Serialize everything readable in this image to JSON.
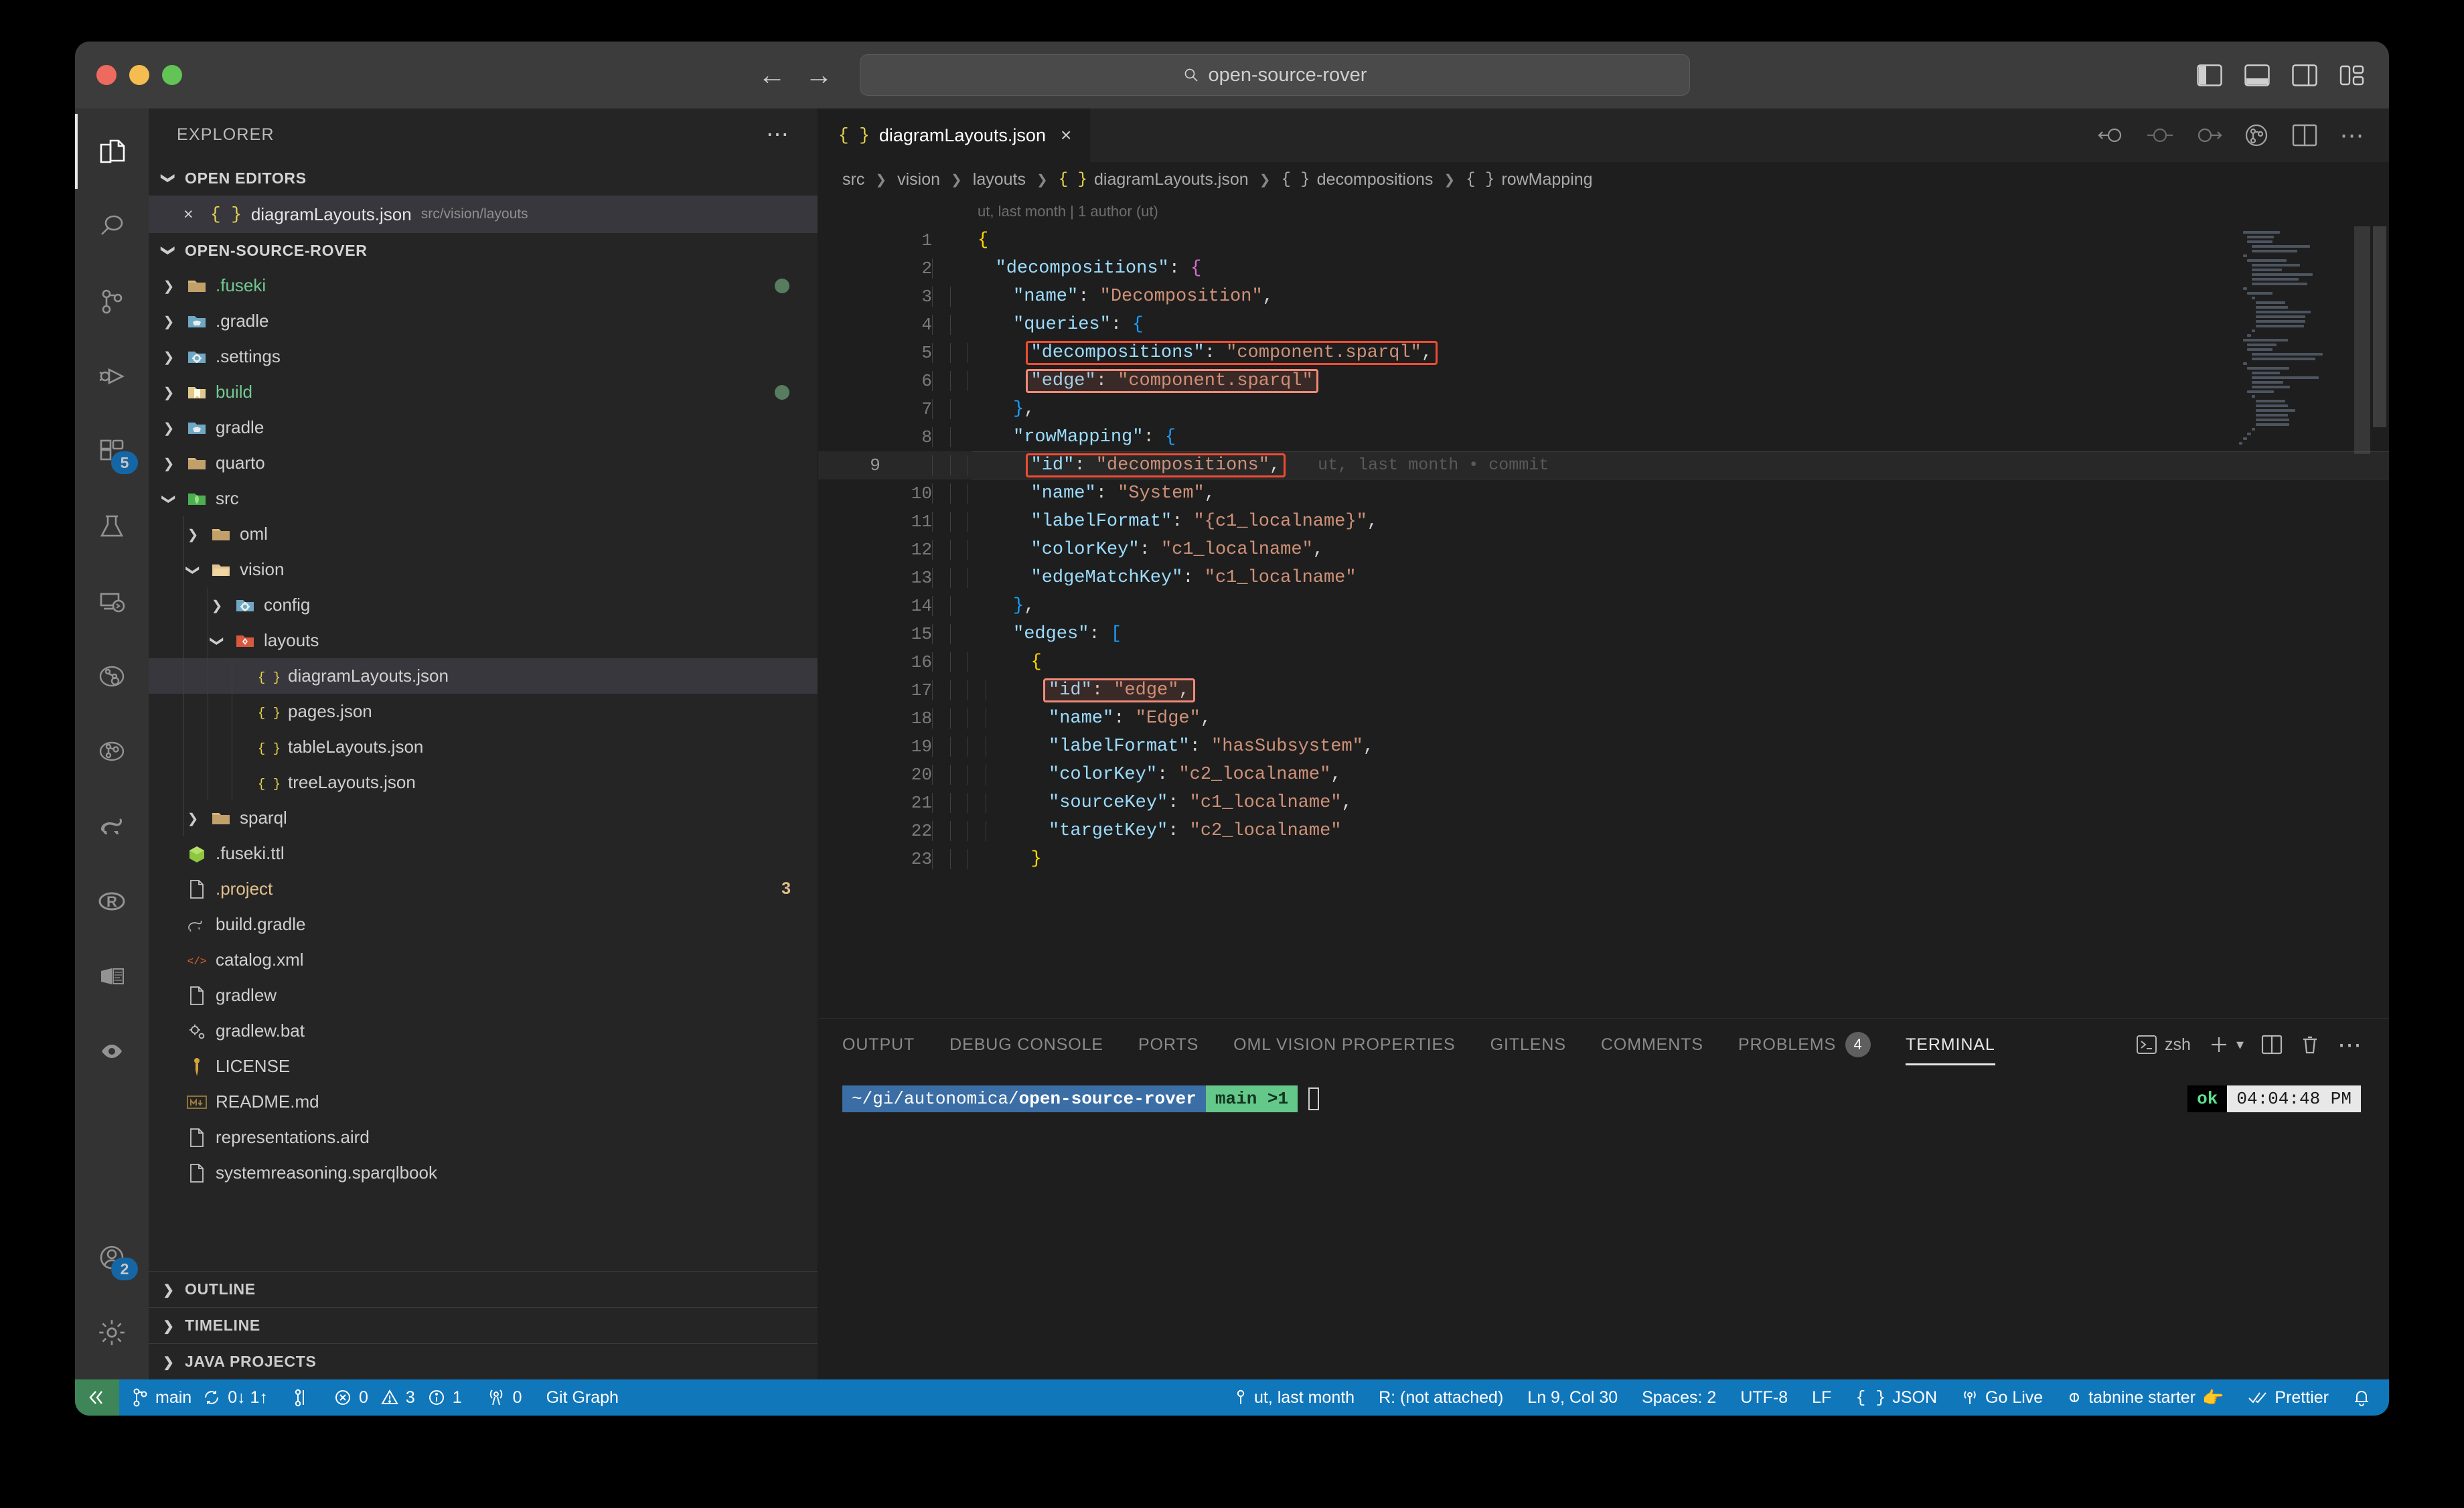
{
  "titlebar": {
    "search_value": "open-source-rover",
    "nav_back": "←",
    "nav_forward": "→"
  },
  "activitybar": {
    "items": [
      {
        "name": "explorer",
        "icon": "files-icon",
        "badge": null,
        "active": true
      },
      {
        "name": "search",
        "icon": "search-icon",
        "badge": null,
        "active": false
      },
      {
        "name": "source-control",
        "icon": "source-control-icon",
        "badge": null,
        "active": false
      },
      {
        "name": "run-and-debug",
        "icon": "run-debug-icon",
        "badge": null,
        "active": false
      },
      {
        "name": "extensions",
        "icon": "extensions-icon",
        "badge": "5",
        "active": false
      },
      {
        "name": "testing",
        "icon": "beaker-icon",
        "badge": null,
        "active": false
      },
      {
        "name": "remote-explorer",
        "icon": "remote-explorer-icon",
        "badge": null,
        "active": false
      },
      {
        "name": "oml-vision",
        "icon": "oml-vision-icon",
        "badge": null,
        "active": false
      },
      {
        "name": "graph-explorer",
        "icon": "graph-circle-icon",
        "badge": null,
        "active": false
      },
      {
        "name": "gradle",
        "icon": "gradle-elephant-icon",
        "badge": null,
        "active": false
      },
      {
        "name": "r-language",
        "icon": "r-icon",
        "badge": null,
        "active": false
      },
      {
        "name": "sirius-web",
        "icon": "sirius-icon",
        "badge": null,
        "active": false
      },
      {
        "name": "watcher",
        "icon": "eye-icon",
        "badge": null,
        "active": false
      }
    ],
    "bottom_items": [
      {
        "name": "accounts",
        "icon": "account-icon",
        "badge": "2"
      },
      {
        "name": "manage-settings",
        "icon": "gear-icon",
        "badge": null
      }
    ]
  },
  "sidebar": {
    "title": "EXPLORER",
    "more_actions": "⋯",
    "open_editors": {
      "label": "OPEN EDITORS",
      "expanded": true,
      "items": [
        {
          "name": "diagramLayouts.json",
          "path": "src/vision/layouts",
          "icon": "json-icon",
          "close": "×",
          "selected": true
        }
      ]
    },
    "workspace": {
      "label": "OPEN-SOURCE-ROVER",
      "expanded": true,
      "tree": [
        {
          "label": ".fuseki",
          "depth": 1,
          "type": "folder",
          "state": "collapsed",
          "icon": "folder-tan-icon",
          "color": "green",
          "dot": true
        },
        {
          "label": ".gradle",
          "depth": 1,
          "type": "folder",
          "state": "collapsed",
          "icon": "folder-gradle-icon",
          "color": "plain",
          "dot": false
        },
        {
          "label": ".settings",
          "depth": 1,
          "type": "folder",
          "state": "collapsed",
          "icon": "folder-config-icon",
          "color": "plain",
          "dot": false
        },
        {
          "label": "build",
          "depth": 1,
          "type": "folder",
          "state": "collapsed",
          "icon": "folder-build-icon",
          "color": "green",
          "dot": true
        },
        {
          "label": "gradle",
          "depth": 1,
          "type": "folder",
          "state": "collapsed",
          "icon": "folder-gradle-icon",
          "color": "plain",
          "dot": false
        },
        {
          "label": "quarto",
          "depth": 1,
          "type": "folder",
          "state": "collapsed",
          "icon": "folder-tan-icon",
          "color": "plain",
          "dot": false
        },
        {
          "label": "src",
          "depth": 1,
          "type": "folder",
          "state": "expanded",
          "icon": "folder-src-icon",
          "color": "plain",
          "dot": false
        },
        {
          "label": "oml",
          "depth": 2,
          "type": "folder",
          "state": "collapsed",
          "icon": "folder-tan-icon",
          "color": "plain",
          "dot": false
        },
        {
          "label": "vision",
          "depth": 2,
          "type": "folder",
          "state": "expanded",
          "icon": "folder-tan-open-icon",
          "color": "plain",
          "dot": false
        },
        {
          "label": "config",
          "depth": 3,
          "type": "folder",
          "state": "collapsed",
          "icon": "folder-config-icon",
          "color": "plain",
          "dot": false
        },
        {
          "label": "layouts",
          "depth": 3,
          "type": "folder",
          "state": "expanded",
          "icon": "folder-layouts-icon",
          "color": "plain",
          "dot": false
        },
        {
          "label": "diagramLayouts.json",
          "depth": 4,
          "type": "file",
          "icon": "json-icon",
          "color": "plain",
          "selected": true,
          "dot": false
        },
        {
          "label": "pages.json",
          "depth": 4,
          "type": "file",
          "icon": "json-icon",
          "color": "plain",
          "dot": false
        },
        {
          "label": "tableLayouts.json",
          "depth": 4,
          "type": "file",
          "icon": "json-icon",
          "color": "plain",
          "dot": false
        },
        {
          "label": "treeLayouts.json",
          "depth": 4,
          "type": "file",
          "icon": "json-icon",
          "color": "plain",
          "dot": false
        },
        {
          "label": "sparql",
          "depth": 2,
          "type": "folder",
          "state": "collapsed",
          "icon": "folder-tan-icon",
          "color": "plain",
          "dot": false
        },
        {
          "label": ".fuseki.ttl",
          "depth": 1,
          "type": "file",
          "icon": "ttl-icon",
          "color": "plain",
          "dot": false
        },
        {
          "label": ".project",
          "depth": 1,
          "type": "file",
          "icon": "file-icon",
          "color": "yellow",
          "count": "3",
          "dot": false
        },
        {
          "label": "build.gradle",
          "depth": 1,
          "type": "file",
          "icon": "gradle-file-icon",
          "color": "plain",
          "dot": false
        },
        {
          "label": "catalog.xml",
          "depth": 1,
          "type": "file",
          "icon": "xml-icon",
          "color": "plain",
          "dot": false
        },
        {
          "label": "gradlew",
          "depth": 1,
          "type": "file",
          "icon": "file-icon",
          "color": "plain",
          "dot": false
        },
        {
          "label": "gradlew.bat",
          "depth": 1,
          "type": "file",
          "icon": "bat-icon",
          "color": "plain",
          "dot": false
        },
        {
          "label": "LICENSE",
          "depth": 1,
          "type": "file",
          "icon": "license-icon",
          "color": "plain",
          "dot": false
        },
        {
          "label": "README.md",
          "depth": 1,
          "type": "file",
          "icon": "markdown-icon",
          "color": "plain",
          "dot": false
        },
        {
          "label": "representations.aird",
          "depth": 1,
          "type": "file",
          "icon": "file-icon",
          "color": "plain",
          "dot": false
        },
        {
          "label": "systemreasoning.sparqlbook",
          "depth": 1,
          "type": "file",
          "icon": "file-icon",
          "color": "plain",
          "dot": false
        }
      ]
    },
    "bottom_sections": [
      {
        "label": "OUTLINE"
      },
      {
        "label": "TIMELINE"
      },
      {
        "label": "JAVA PROJECTS"
      }
    ]
  },
  "editor": {
    "tab": {
      "name": "diagramLayouts.json",
      "icon": "json-icon",
      "close": "×"
    },
    "actions": [
      "go-back-icon",
      "no-change-icon",
      "go-forward-icon",
      "git-compare-icon",
      "split-editor-icon",
      "more-actions-icon"
    ],
    "breadcrumb": [
      "src",
      "vision",
      "layouts",
      "diagramLayouts.json",
      "decompositions",
      "rowMapping"
    ],
    "blame_header": "ut, last month | 1 author (ut)",
    "inline_blame": "ut, last month • commit",
    "cursor_line": 9,
    "lines": [
      {
        "n": 1,
        "indent": 0,
        "tokens": [
          {
            "t": "{",
            "c": "br-y"
          }
        ]
      },
      {
        "n": 2,
        "indent": 1,
        "tokens": [
          {
            "t": "\"decompositions\"",
            "c": "k"
          },
          {
            "t": ": ",
            "c": "p"
          },
          {
            "t": "{",
            "c": "br-p"
          }
        ]
      },
      {
        "n": 3,
        "indent": 2,
        "tokens": [
          {
            "t": "\"name\"",
            "c": "k"
          },
          {
            "t": ": ",
            "c": "p"
          },
          {
            "t": "\"Decomposition\"",
            "c": "s"
          },
          {
            "t": ",",
            "c": "p"
          }
        ]
      },
      {
        "n": 4,
        "indent": 2,
        "tokens": [
          {
            "t": "\"queries\"",
            "c": "k"
          },
          {
            "t": ": ",
            "c": "p"
          },
          {
            "t": "{",
            "c": "br-b"
          }
        ]
      },
      {
        "n": 5,
        "indent": 3,
        "tokens": [
          {
            "t": "\"decompositions\"",
            "c": "k"
          },
          {
            "t": ": ",
            "c": "p"
          },
          {
            "t": "\"component.sparql\"",
            "c": "s"
          },
          {
            "t": ",",
            "c": "p"
          }
        ],
        "highlight": "strong"
      },
      {
        "n": 6,
        "indent": 3,
        "tokens": [
          {
            "t": "\"edge\"",
            "c": "k"
          },
          {
            "t": ": ",
            "c": "p"
          },
          {
            "t": "\"component.sparql\"",
            "c": "s"
          }
        ],
        "highlight": "soft"
      },
      {
        "n": 7,
        "indent": 2,
        "tokens": [
          {
            "t": "}",
            "c": "br-b"
          },
          {
            "t": ",",
            "c": "p"
          }
        ]
      },
      {
        "n": 8,
        "indent": 2,
        "tokens": [
          {
            "t": "\"rowMapping\"",
            "c": "k"
          },
          {
            "t": ": ",
            "c": "p"
          },
          {
            "t": "{",
            "c": "br-b"
          }
        ]
      },
      {
        "n": 9,
        "indent": 3,
        "tokens": [
          {
            "t": "\"id\"",
            "c": "k"
          },
          {
            "t": ": ",
            "c": "p"
          },
          {
            "t": "\"decompositions\"",
            "c": "s"
          },
          {
            "t": ",",
            "c": "p"
          }
        ],
        "highlight": "strong",
        "blame": true
      },
      {
        "n": 10,
        "indent": 3,
        "tokens": [
          {
            "t": "\"name\"",
            "c": "k"
          },
          {
            "t": ": ",
            "c": "p"
          },
          {
            "t": "\"System\"",
            "c": "s"
          },
          {
            "t": ",",
            "c": "p"
          }
        ]
      },
      {
        "n": 11,
        "indent": 3,
        "tokens": [
          {
            "t": "\"labelFormat\"",
            "c": "k"
          },
          {
            "t": ": ",
            "c": "p"
          },
          {
            "t": "\"{c1_localname}\"",
            "c": "s"
          },
          {
            "t": ",",
            "c": "p"
          }
        ]
      },
      {
        "n": 12,
        "indent": 3,
        "tokens": [
          {
            "t": "\"colorKey\"",
            "c": "k"
          },
          {
            "t": ": ",
            "c": "p"
          },
          {
            "t": "\"c1_localname\"",
            "c": "s"
          },
          {
            "t": ",",
            "c": "p"
          }
        ]
      },
      {
        "n": 13,
        "indent": 3,
        "tokens": [
          {
            "t": "\"edgeMatchKey\"",
            "c": "k"
          },
          {
            "t": ": ",
            "c": "p"
          },
          {
            "t": "\"c1_localname\"",
            "c": "s"
          }
        ]
      },
      {
        "n": 14,
        "indent": 2,
        "tokens": [
          {
            "t": "}",
            "c": "br-b"
          },
          {
            "t": ",",
            "c": "p"
          }
        ]
      },
      {
        "n": 15,
        "indent": 2,
        "tokens": [
          {
            "t": "\"edges\"",
            "c": "k"
          },
          {
            "t": ": ",
            "c": "p"
          },
          {
            "t": "[",
            "c": "br-b"
          }
        ]
      },
      {
        "n": 16,
        "indent": 3,
        "tokens": [
          {
            "t": "{",
            "c": "br-y"
          }
        ]
      },
      {
        "n": 17,
        "indent": 4,
        "tokens": [
          {
            "t": "\"id\"",
            "c": "k"
          },
          {
            "t": ": ",
            "c": "p"
          },
          {
            "t": "\"edge\"",
            "c": "s"
          },
          {
            "t": ",",
            "c": "p"
          }
        ],
        "highlight": "soft"
      },
      {
        "n": 18,
        "indent": 4,
        "tokens": [
          {
            "t": "\"name\"",
            "c": "k"
          },
          {
            "t": ": ",
            "c": "p"
          },
          {
            "t": "\"Edge\"",
            "c": "s"
          },
          {
            "t": ",",
            "c": "p"
          }
        ]
      },
      {
        "n": 19,
        "indent": 4,
        "tokens": [
          {
            "t": "\"labelFormat\"",
            "c": "k"
          },
          {
            "t": ": ",
            "c": "p"
          },
          {
            "t": "\"hasSubsystem\"",
            "c": "s"
          },
          {
            "t": ",",
            "c": "p"
          }
        ]
      },
      {
        "n": 20,
        "indent": 4,
        "tokens": [
          {
            "t": "\"colorKey\"",
            "c": "k"
          },
          {
            "t": ": ",
            "c": "p"
          },
          {
            "t": "\"c2_localname\"",
            "c": "s"
          },
          {
            "t": ",",
            "c": "p"
          }
        ]
      },
      {
        "n": 21,
        "indent": 4,
        "tokens": [
          {
            "t": "\"sourceKey\"",
            "c": "k"
          },
          {
            "t": ": ",
            "c": "p"
          },
          {
            "t": "\"c1_localname\"",
            "c": "s"
          },
          {
            "t": ",",
            "c": "p"
          }
        ]
      },
      {
        "n": 22,
        "indent": 4,
        "tokens": [
          {
            "t": "\"targetKey\"",
            "c": "k"
          },
          {
            "t": ": ",
            "c": "p"
          },
          {
            "t": "\"c2_localname\"",
            "c": "s"
          }
        ]
      },
      {
        "n": 23,
        "indent": 3,
        "tokens": [
          {
            "t": "}",
            "c": "br-y"
          }
        ]
      }
    ]
  },
  "panel": {
    "tabs": [
      {
        "label": "OUTPUT",
        "active": false,
        "badge": null
      },
      {
        "label": "DEBUG CONSOLE",
        "active": false,
        "badge": null
      },
      {
        "label": "PORTS",
        "active": false,
        "badge": null
      },
      {
        "label": "OML VISION PROPERTIES",
        "active": false,
        "badge": null
      },
      {
        "label": "GITLENS",
        "active": false,
        "badge": null
      },
      {
        "label": "COMMENTS",
        "active": false,
        "badge": null
      },
      {
        "label": "PROBLEMS",
        "active": false,
        "badge": "4"
      },
      {
        "label": "TERMINAL",
        "active": true,
        "badge": null
      }
    ],
    "shell": "zsh",
    "actions": [
      "terminal-icon",
      "new-terminal-icon",
      "chevron-down-icon",
      "split-terminal-icon",
      "kill-terminal-icon",
      "more-actions-icon"
    ],
    "terminal": {
      "path_prefix": "~/gi/autonomica/",
      "path_repo": "open-source-rover",
      "branch": "main >1",
      "status": "ok",
      "time": "04:04:48 PM"
    }
  },
  "statusbar": {
    "left": [
      {
        "name": "remote-indicator",
        "label": "",
        "icon": "remote-icon"
      },
      {
        "name": "branch",
        "label": "main",
        "icon": "git-branch-icon"
      },
      {
        "name": "sync",
        "label": "0↓ 1↑",
        "icon": "sync-icon"
      },
      {
        "name": "git-stash",
        "label": "",
        "icon": "git-stash-icon"
      },
      {
        "name": "errors",
        "label": "0",
        "icon": "error-icon"
      },
      {
        "name": "warnings",
        "label": "3",
        "icon": "warning-icon"
      },
      {
        "name": "infos",
        "label": "1",
        "icon": "info-icon"
      },
      {
        "name": "radio-tower",
        "label": "0",
        "icon": "radio-tower-icon"
      },
      {
        "name": "git-graph",
        "label": "Git Graph",
        "icon": null
      }
    ],
    "right": [
      {
        "name": "gitlens-blame",
        "label": "ut, last month",
        "icon": "gitlens-icon"
      },
      {
        "name": "r-session",
        "label": "R: (not attached)",
        "icon": null
      },
      {
        "name": "cursor-position",
        "label": "Ln 9, Col 30",
        "icon": null
      },
      {
        "name": "indentation",
        "label": "Spaces: 2",
        "icon": null
      },
      {
        "name": "encoding",
        "label": "UTF-8",
        "icon": null
      },
      {
        "name": "eol",
        "label": "LF",
        "icon": null
      },
      {
        "name": "language-mode",
        "label": "JSON",
        "icon": "json-brackets-icon"
      },
      {
        "name": "go-live",
        "label": "Go Live",
        "icon": "broadcast-icon"
      },
      {
        "name": "tabnine",
        "label": "tabnine starter",
        "icon": "tabnine-icon"
      },
      {
        "name": "prettier",
        "label": "Prettier",
        "icon": "check-check-icon"
      },
      {
        "name": "notifications",
        "label": "",
        "icon": "bell-icon"
      }
    ]
  },
  "colors": {
    "accent_blue": "#1177bb",
    "highlight_red": "#f14c32",
    "highlight_soft": "#f08a78",
    "editor_bg": "#1e1e1e",
    "sidebar_bg": "#252526",
    "activitybar_bg": "#333333",
    "string_color": "#ce9178",
    "key_color": "#9cdcfe"
  }
}
